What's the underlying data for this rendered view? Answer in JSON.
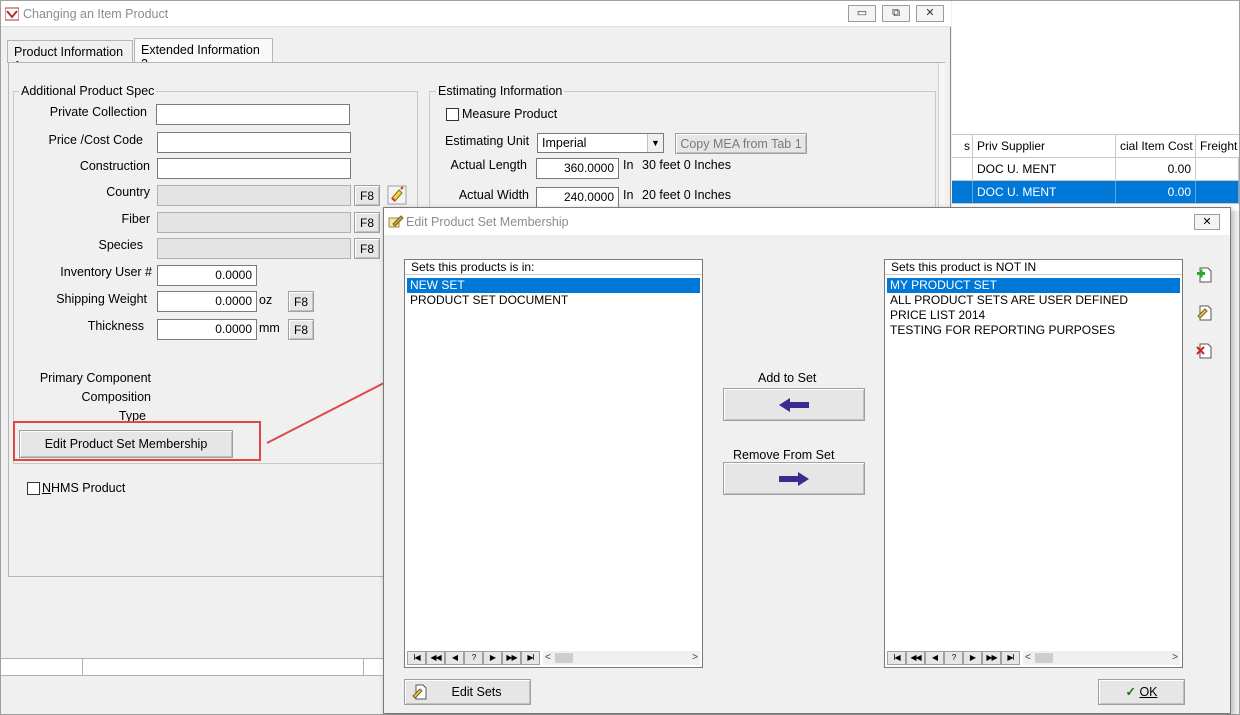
{
  "main_window": {
    "title": "Changing an Item Product",
    "minimize_glyph": "▭",
    "restore_glyph": "⧉",
    "close_glyph": "✕"
  },
  "tabs": [
    {
      "label": "Product Information ",
      "shortcut": "1"
    },
    {
      "label": "Extended Information ",
      "shortcut": "2"
    }
  ],
  "additional_spec": {
    "legend": "Additional Product Spec",
    "private_collection_label": "Private Collection",
    "price_cost_code_label": "Price /Cost Code",
    "construction_label": "Construction",
    "country_label": "Country",
    "fiber_label": "Fiber",
    "species_label": "Species",
    "inventory_user_label": "Inventory User #",
    "inventory_user_value": "0.0000",
    "shipping_weight_label": "Shipping Weight",
    "shipping_weight_value": "0.0000",
    "shipping_weight_unit": "oz",
    "thickness_label": "Thickness",
    "thickness_value": "0.0000",
    "thickness_unit": "mm",
    "f8": "F8",
    "primary_component_label": "Primary Component",
    "composition_label": "Composition",
    "type_label": "Type",
    "edit_membership_button": "Edit Product Set Membership",
    "nhms_first": "N",
    "nhms_rest": "HMS Product"
  },
  "estimating": {
    "legend": "Estimating Information",
    "measure_product_label": "Measure Product",
    "estimating_unit_label": "Estimating Unit",
    "estimating_unit_value": "Imperial",
    "copy_mea_button": "Copy MEA from Tab 1",
    "actual_length_label": "Actual Length",
    "actual_length_value": "360.0000",
    "actual_length_unit": "In",
    "actual_length_text": "30 feet 0 Inches",
    "actual_width_label": "Actual Width",
    "actual_width_value": "240.0000",
    "actual_width_unit": "In",
    "actual_width_text": "20 feet 0 Inches"
  },
  "background_grid": {
    "headers": [
      "s",
      "Priv Supplier",
      "cial Item Cost",
      "Freight"
    ],
    "rows": [
      {
        "supplier": "DOC U. MENT",
        "cost": "0.00"
      },
      {
        "supplier": "DOC U. MENT",
        "cost": "0.00"
      }
    ]
  },
  "dialog": {
    "title": "Edit Product Set Membership",
    "close_glyph": "✕",
    "in_sets_header": "Sets this products is in:",
    "in_sets": [
      "NEW SET",
      "PRODUCT SET DOCUMENT"
    ],
    "not_in_header": "Sets this product is NOT IN",
    "not_in_sets": [
      "MY PRODUCT SET",
      "ALL PRODUCT SETS ARE USER DEFINED",
      "PRICE LIST 2014",
      "TESTING FOR REPORTING PURPOSES"
    ],
    "add_label": "Add to Set",
    "remove_label": "Remove From Set",
    "edit_sets_button": "Edit Sets",
    "ok_button": "OK",
    "ok_check": "✓",
    "nav": [
      "I◀",
      "◀◀",
      "◀",
      "?",
      "▶",
      "▶▶",
      "▶I"
    ]
  },
  "colors": {
    "selection": "#0078d7",
    "highlight": "#e04848",
    "arrow": "#3b2b8e"
  }
}
